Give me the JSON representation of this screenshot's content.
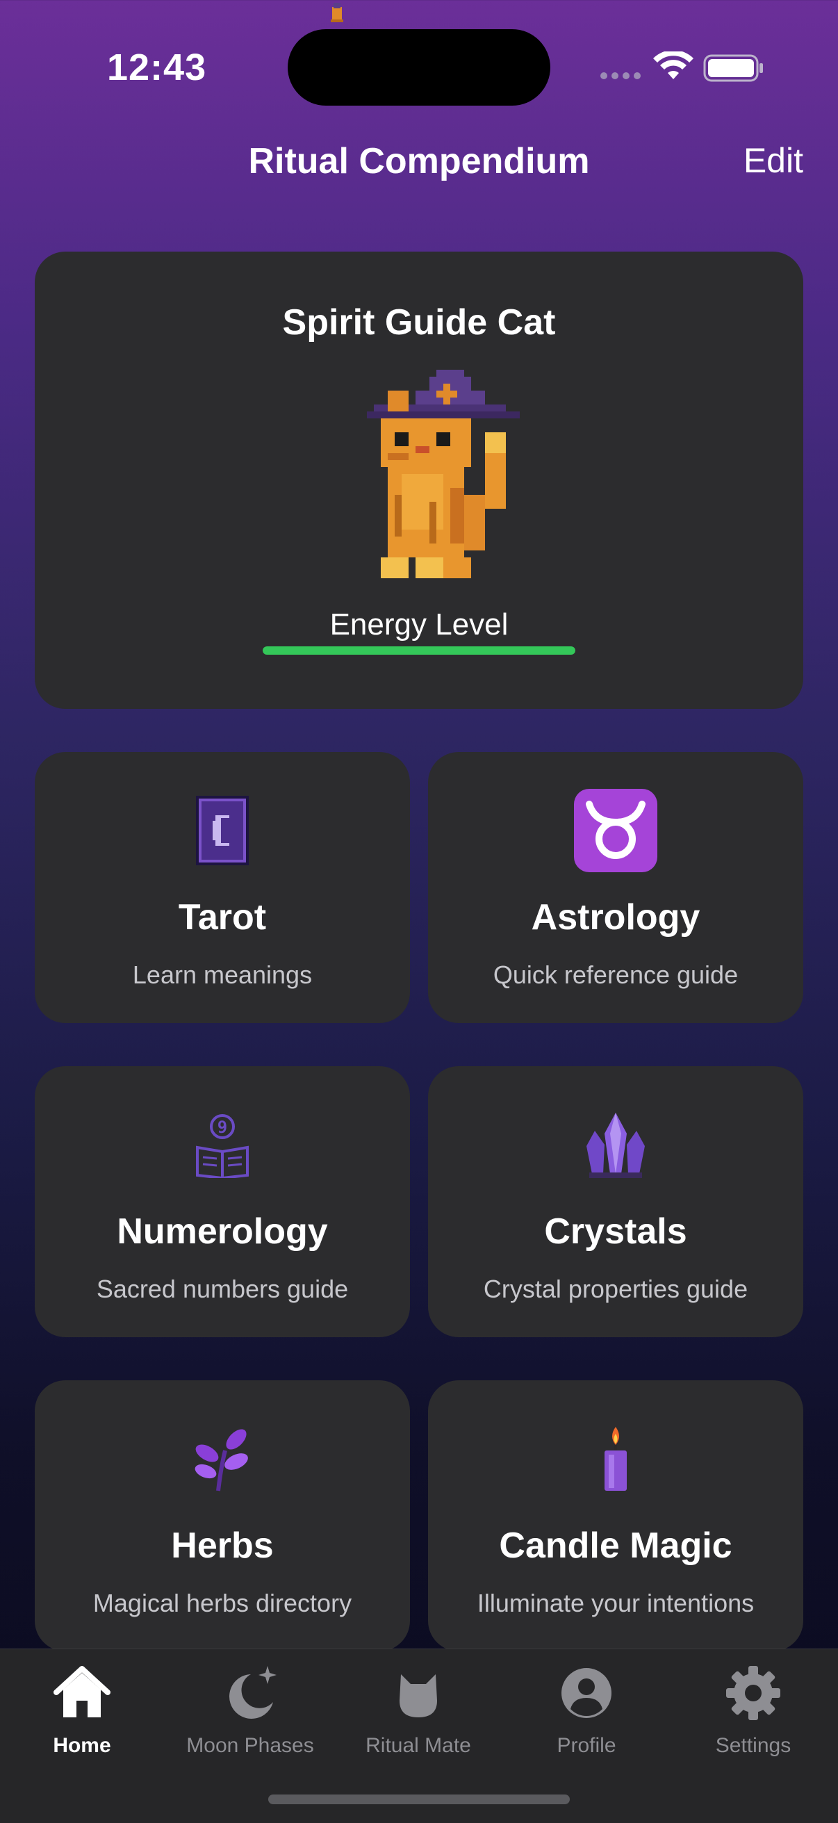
{
  "status_bar": {
    "time": "12:43"
  },
  "nav": {
    "title": "Ritual Compendium",
    "edit_label": "Edit"
  },
  "hero": {
    "title": "Spirit Guide Cat",
    "energy_label": "Energy Level",
    "energy_level": 1.0,
    "energy_color": "#34c759"
  },
  "tiles": [
    {
      "title": "Tarot",
      "subtitle": "Learn meanings",
      "icon": "tarot-card-moon-icon"
    },
    {
      "title": "Astrology",
      "subtitle": "Quick reference guide",
      "icon": "taurus-icon"
    },
    {
      "title": "Numerology",
      "subtitle": "Sacred numbers guide",
      "icon": "numerology-book-icon"
    },
    {
      "title": "Crystals",
      "subtitle": "Crystal properties guide",
      "icon": "crystal-cluster-icon"
    },
    {
      "title": "Herbs",
      "subtitle": "Magical herbs directory",
      "icon": "herb-sprig-icon"
    },
    {
      "title": "Candle Magic",
      "subtitle": "Illuminate your intentions",
      "icon": "candle-icon"
    }
  ],
  "tabs": [
    {
      "label": "Home",
      "icon": "home-icon",
      "active": true
    },
    {
      "label": "Moon Phases",
      "icon": "moon-stars-icon",
      "active": false
    },
    {
      "label": "Ritual Mate",
      "icon": "cat-head-icon",
      "active": false
    },
    {
      "label": "Profile",
      "icon": "profile-icon",
      "active": false
    },
    {
      "label": "Settings",
      "icon": "gear-icon",
      "active": false
    }
  ],
  "colors": {
    "card": "#2c2c2e",
    "accent_purple": "#7b52c9",
    "active_tab": "#ffffff",
    "inactive_tab": "#8e8e93"
  }
}
